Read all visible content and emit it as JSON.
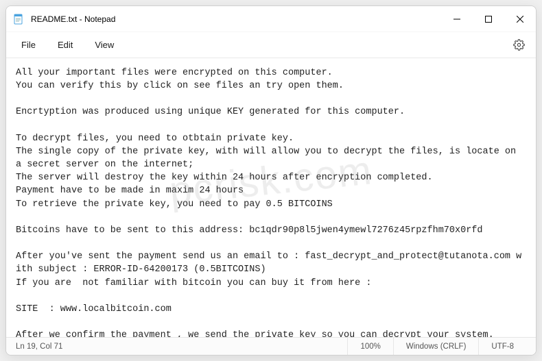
{
  "window": {
    "title": "README.txt - Notepad"
  },
  "menu": {
    "file": "File",
    "edit": "Edit",
    "view": "View"
  },
  "content": {
    "text": "All your important files were encrypted on this computer.\nYou can verify this by click on see files an try open them.\n\nEncrtyption was produced using unique KEY generated for this computer.\n\nTo decrypt files, you need to otbtain private key.\nThe single copy of the private key, with will allow you to decrypt the files, is locate on a secret server on the internet;\nThe server will destroy the key within 24 hours after encryption completed.\nPayment have to be made in maxim 24 hours\nTo retrieve the private key, you need to pay 0.5 BITCOINS\n\nBitcoins have to be sent to this address: bc1qdr90p8l5jwen4ymewl7276z45rpzfhm70x0rfd\n\nAfter you've sent the payment send us an email to : fast_decrypt_and_protect@tutanota.com with subject : ERROR-ID-64200173 (0.5BITCOINS)\nIf you are  not familiar with bitcoin you can buy it from here :\n\nSITE  : www.localbitcoin.com\n\nAfter we confirm the payment , we send the private key so you can decrypt your system."
  },
  "statusbar": {
    "position": "Ln 19, Col 71",
    "zoom": "100%",
    "line_ending": "Windows (CRLF)",
    "encoding": "UTF-8"
  },
  "watermark": "pcrisk.com"
}
